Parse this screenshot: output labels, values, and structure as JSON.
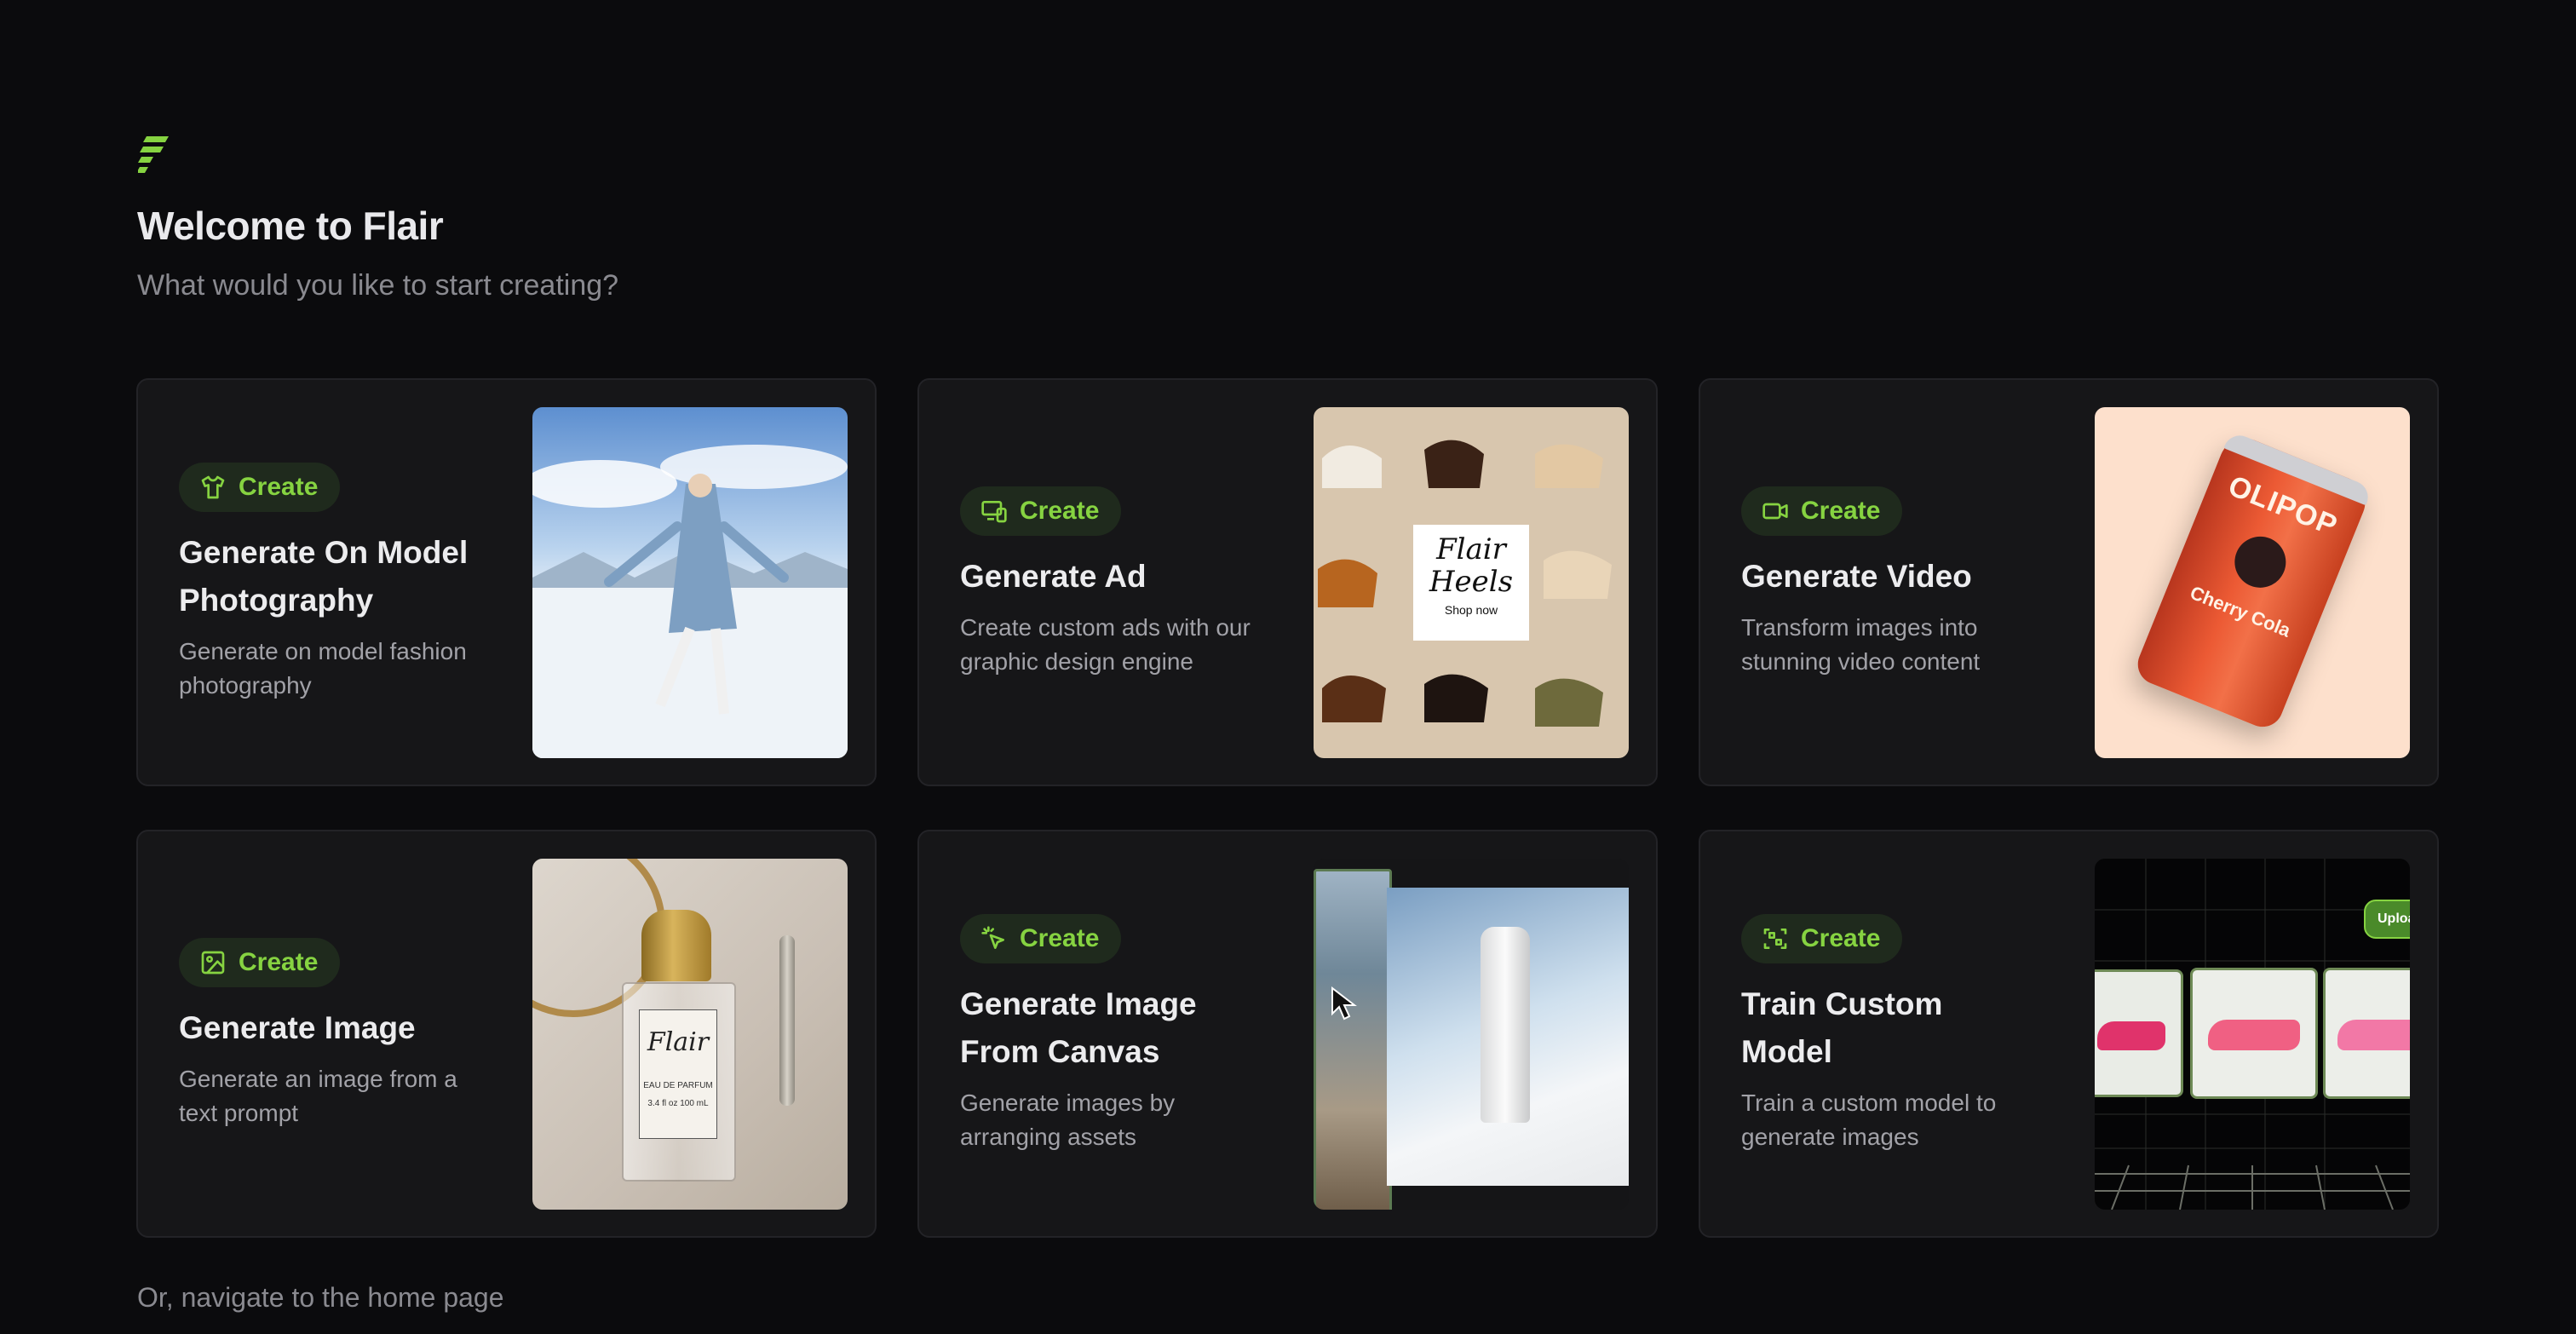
{
  "header": {
    "logo_icon": "flair-logo-icon",
    "title": "Welcome to Flair",
    "subtitle": "What would you like to start creating?"
  },
  "accent_color": "#86d341",
  "cards": [
    {
      "badge_label": "Create",
      "badge_icon": "shirt-icon",
      "title": "Generate On Model Photography",
      "description": "Generate on model fashion photography",
      "thumbnail": "woman-in-blue-coat-skating-on-snow"
    },
    {
      "badge_label": "Create",
      "badge_icon": "devices-icon",
      "title": "Generate Ad",
      "description": "Create custom ads with our graphic design engine",
      "thumbnail": "shoe-grid-ad",
      "thumbnail_text": {
        "line1": "Flair",
        "line2": "Heels",
        "cta": "Shop now"
      }
    },
    {
      "badge_label": "Create",
      "badge_icon": "video-camera-icon",
      "title": "Generate Video",
      "description": "Transform images into stunning video content",
      "thumbnail": "olipop-can",
      "thumbnail_text": {
        "brand": "OLIPOP",
        "flavor": "Cherry Cola"
      }
    },
    {
      "badge_label": "Create",
      "badge_icon": "image-icon",
      "title": "Generate Image",
      "description": "Generate an image from a text prompt",
      "thumbnail": "flair-perfume-bottle",
      "thumbnail_text": {
        "brand": "Flair",
        "type": "EAU DE PARFUM",
        "size": "3.4 fl oz 100 mL"
      }
    },
    {
      "badge_label": "Create",
      "badge_icon": "cursor-click-icon",
      "title": "Generate Image From Canvas",
      "description": "Generate images by arranging assets",
      "thumbnail": "canvas-skincare-bottle"
    },
    {
      "badge_label": "Create",
      "badge_icon": "scan-icon",
      "title": "Train Custom Model",
      "description": "Train a custom model to generate images",
      "thumbnail": "pink-sneakers-training",
      "thumbnail_text": {
        "upload_badge": "Uploa"
      }
    }
  ],
  "footer": {
    "link_text": "Or, navigate to the home page"
  }
}
